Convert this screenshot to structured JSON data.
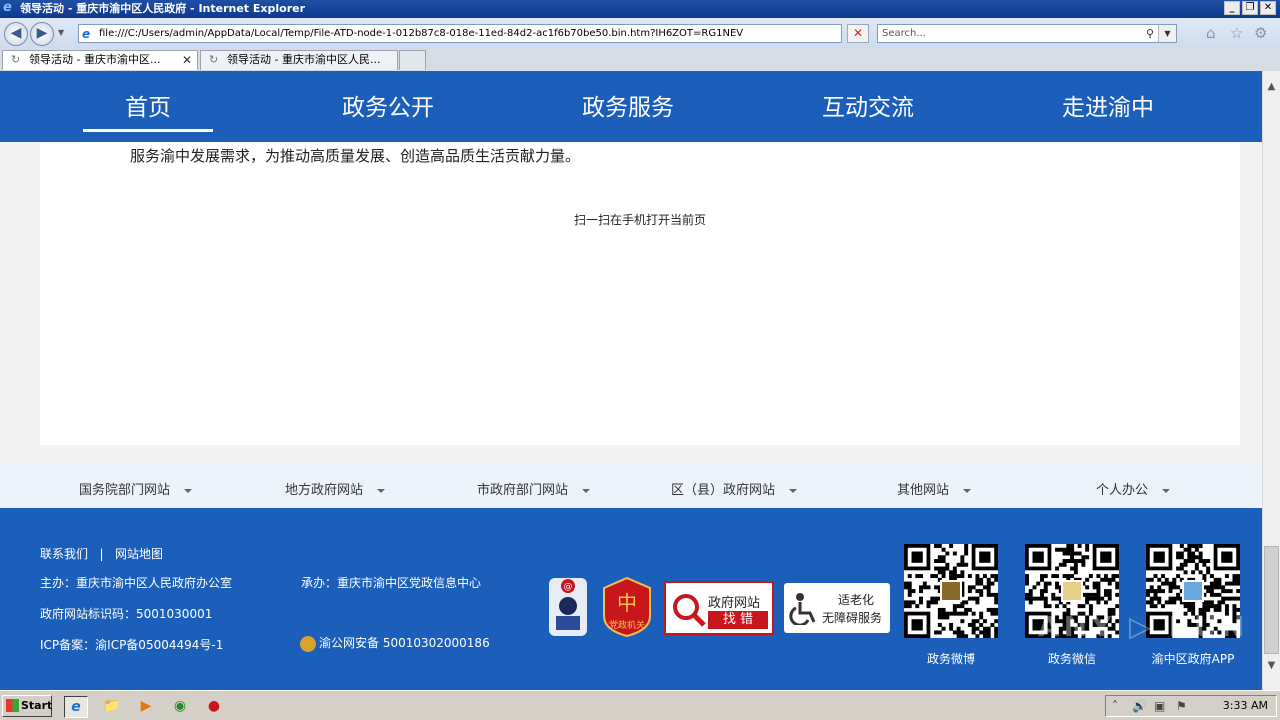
{
  "window": {
    "title": "领导活动 - 重庆市渝中区人民政府 - Internet Explorer",
    "minimize": "_",
    "restore": "❐",
    "close": "✕"
  },
  "browser": {
    "url": "file:///C:/Users/admin/AppData/Local/Temp/File-ATD-node-1-012b87c8-018e-11ed-84d2-ac1f6b70be50.bin.htm?IH6ZOT=RG1NEV",
    "search_placeholder": "Search...",
    "tabs": [
      {
        "label": "领导活动 - 重庆市渝中区..."
      },
      {
        "label": "领导活动 - 重庆市渝中区人民..."
      }
    ]
  },
  "site_nav": {
    "items": [
      {
        "label": "首页"
      },
      {
        "label": "政务公开"
      },
      {
        "label": "政务服务"
      },
      {
        "label": "互动交流"
      },
      {
        "label": "走进渝中"
      }
    ],
    "active_index": 0
  },
  "content": {
    "body_text": "服务渝中发展需求，为推动高质量发展、创造高品质生活贡献力量。",
    "qr_caption": "扫一扫在手机打开当前页"
  },
  "links_bar": {
    "items": [
      {
        "label": "国务院部门网站"
      },
      {
        "label": "地方政府网站"
      },
      {
        "label": "市政府部门网站"
      },
      {
        "label": "区（县）政府网站"
      },
      {
        "label": "其他网站"
      },
      {
        "label": "个人办公"
      }
    ]
  },
  "footer": {
    "contact": "联系我们",
    "separator": "|",
    "sitemap": "网站地图",
    "sponsor": "主办：重庆市渝中区人民政府办公室",
    "organizer": "承办：重庆市渝中区党政信息中心",
    "site_id": "政府网站标识码：5001030001",
    "icp": "ICP备案：渝ICP备05004494号-1",
    "police_record": "渝公网安备 50010302000186",
    "badges": {
      "party_org": "党政机关",
      "error_report_line1": "政府网站",
      "error_report_line2": "找 错",
      "elder_line1": "适老化",
      "elder_line2": "无障碍服务"
    },
    "qr_labels": [
      "政务微博",
      "政务微信",
      "渝中区政府APP"
    ],
    "watermark": "ANY ▷ RUN"
  },
  "taskbar": {
    "start": "Start",
    "clock": "3:33 AM"
  },
  "colors": {
    "site_blue": "#1c5fbb",
    "links_bar_bg": "#edf3fb",
    "error_badge_red": "#c8161d",
    "party_badge_red": "#c8161d"
  }
}
